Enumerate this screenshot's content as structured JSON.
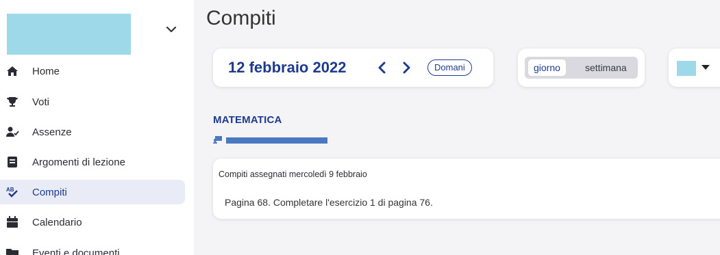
{
  "sidebar": {
    "items": [
      {
        "label": "Home",
        "icon": "home-icon"
      },
      {
        "label": "Voti",
        "icon": "trophy-icon"
      },
      {
        "label": "Assenze",
        "icon": "user-check-icon"
      },
      {
        "label": "Argomenti di lezione",
        "icon": "book-icon"
      },
      {
        "label": "Compiti",
        "icon": "spellcheck-icon",
        "active": true
      },
      {
        "label": "Calendario",
        "icon": "calendar-icon"
      },
      {
        "label": "Eventi e documenti",
        "icon": "folder-icon"
      }
    ]
  },
  "page": {
    "title": "Compiti"
  },
  "date_nav": {
    "date": "12 febbraio 2022",
    "today_label": "Domani"
  },
  "view_toggle": {
    "day_label": "giorno",
    "week_label": "settimana",
    "selected": "giorno"
  },
  "homework": {
    "subject": "MATEMATICA",
    "assigned_label": "Compiti assegnati mercoledì 9 febbraio",
    "text": "Pagina 68. Completare l'esercizio 1 di pagina 76."
  },
  "colors": {
    "accent": "#1d3a8f",
    "active_bg": "#e9ecf6",
    "redaction": "#9ed9e9",
    "teacher_bar": "#4a78c2"
  }
}
